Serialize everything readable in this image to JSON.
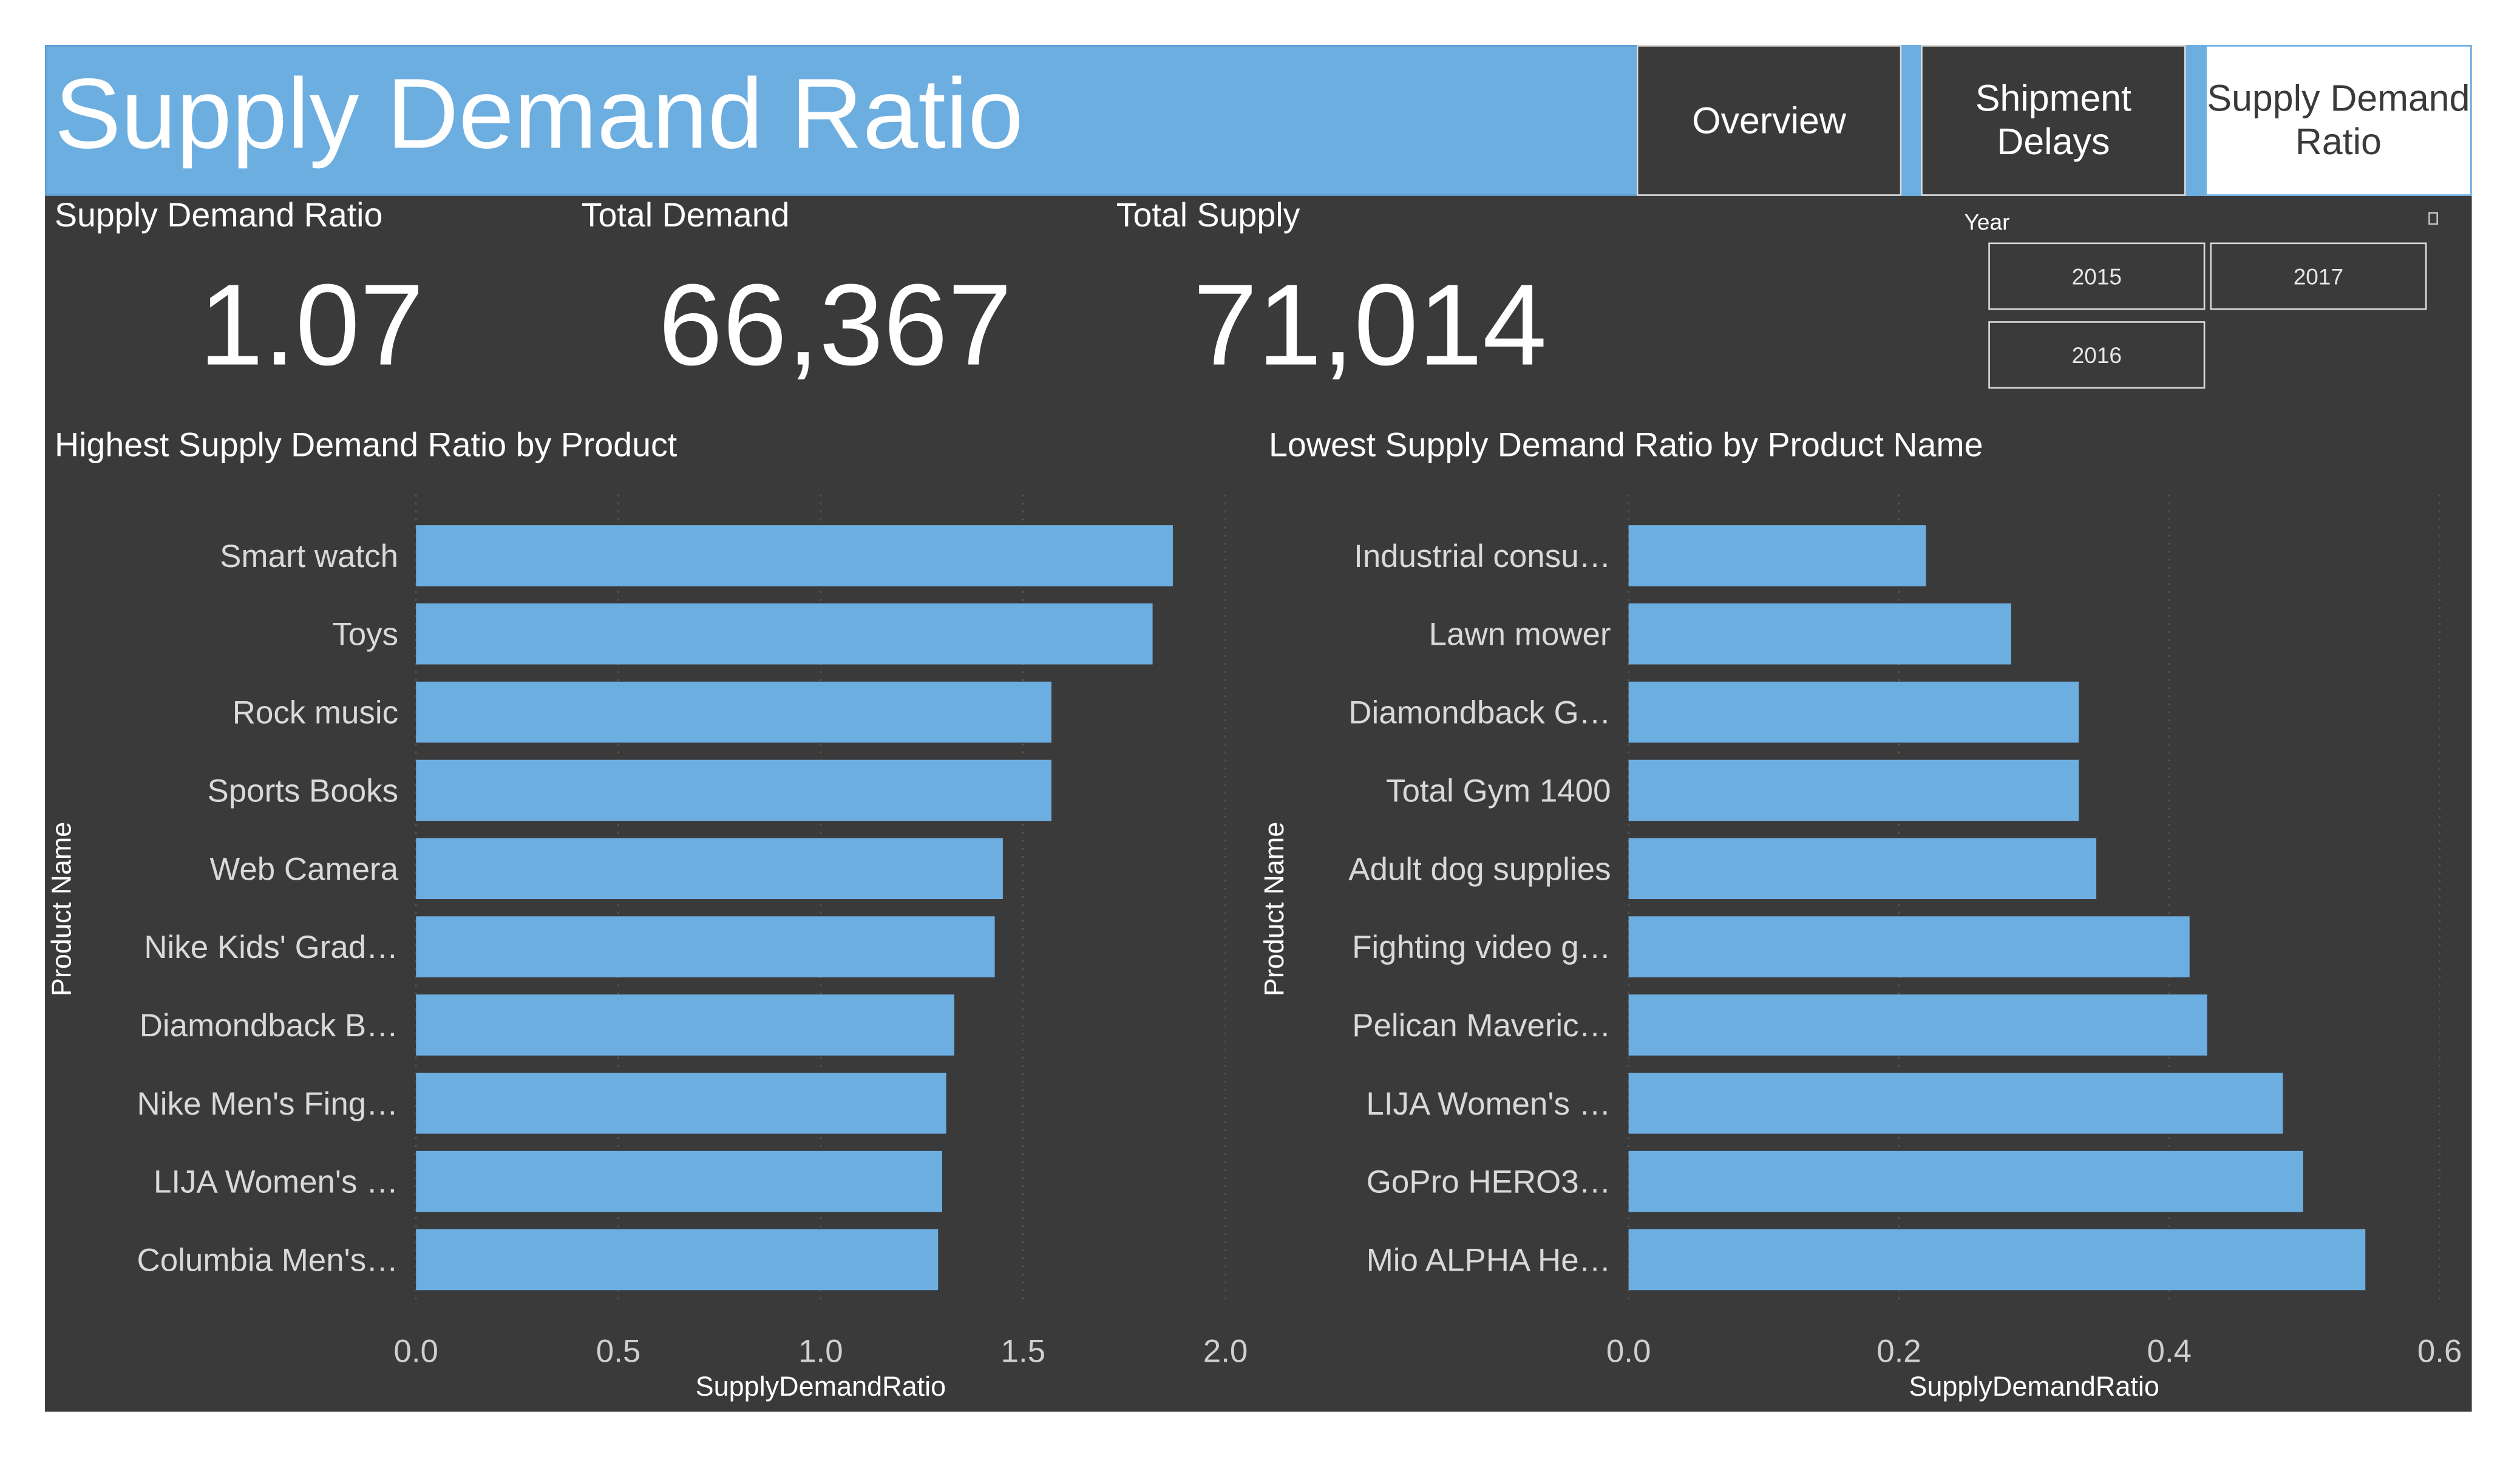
{
  "header": {
    "title": "Supply Demand Ratio",
    "nav": [
      "Overview",
      "Shipment Delays",
      "Supply Demand Ratio"
    ],
    "active_nav": "Supply Demand Ratio"
  },
  "kpis": [
    {
      "label": "Supply Demand Ratio",
      "value": "1.07"
    },
    {
      "label": "Total Demand",
      "value": "66,367"
    },
    {
      "label": "Total Supply",
      "value": "71,014"
    }
  ],
  "slicer": {
    "title": "Year",
    "options": [
      "2015",
      "2017",
      "2016"
    ]
  },
  "colors": {
    "background": "#3a3a3a",
    "accent": "#6daee1",
    "bar": "#6daee1",
    "text": "#ffffff"
  },
  "chart_data": [
    {
      "type": "bar",
      "orientation": "horizontal",
      "title": "Highest Supply Demand Ratio by Product",
      "xlabel": "SupplyDemandRatio",
      "ylabel": "Product Name",
      "xlim": [
        0,
        2.0
      ],
      "xticks": [
        "0.0",
        "0.5",
        "1.0",
        "1.5",
        "2.0"
      ],
      "grid": true,
      "categories": [
        "Smart watch",
        "Toys",
        "Rock music",
        "Sports Books",
        "Web Camera",
        "Nike Kids' Grad…",
        "Diamondback B…",
        "Nike Men's Fing…",
        "LIJA Women's …",
        "Columbia Men's…"
      ],
      "values": [
        1.87,
        1.82,
        1.57,
        1.57,
        1.45,
        1.43,
        1.33,
        1.31,
        1.3,
        1.29
      ]
    },
    {
      "type": "bar",
      "orientation": "horizontal",
      "title": "Lowest Supply Demand Ratio by Product Name",
      "xlabel": "SupplyDemandRatio",
      "ylabel": "Product Name",
      "xlim": [
        0,
        0.6
      ],
      "xticks": [
        "0.0",
        "0.2",
        "0.4",
        "0.6"
      ],
      "grid": true,
      "categories": [
        "Industrial consu…",
        "Lawn mower",
        "Diamondback G…",
        "Total Gym 1400",
        "Adult dog supplies",
        "Fighting video g…",
        "Pelican Maveric…",
        "LIJA Women's …",
        "GoPro HERO3…",
        "Mio ALPHA He…"
      ],
      "values": [
        0.22,
        0.283,
        0.333,
        0.333,
        0.346,
        0.415,
        0.428,
        0.484,
        0.499,
        0.545
      ]
    }
  ]
}
